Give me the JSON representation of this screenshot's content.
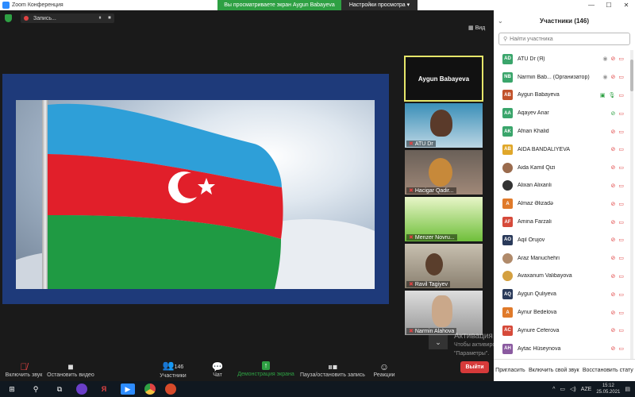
{
  "window": {
    "title": "Zoom Конференция"
  },
  "topbar": {
    "recording_label": "Запись...",
    "pause_icon": "⏸",
    "stop_icon": "⏹",
    "share_banner": "Вы просматриваете экран Aygun Babayeva",
    "view_options": "Настройки просмотра",
    "view_label": "Вид"
  },
  "video": {
    "self_view_name": "Aygun Babayeva",
    "tiles": [
      {
        "name": "ATU Dr"
      },
      {
        "name": "Hacigar Qadir..."
      },
      {
        "name": "Menzer Novru..."
      },
      {
        "name": "Ravil Tagiyev"
      },
      {
        "name": "Narmin Alahova"
      }
    ]
  },
  "watermark": {
    "line1": "Активация Windows",
    "line2": "Чтобы активировать Windows, перейдите в раздел",
    "line3": "\"Параметры\"."
  },
  "controls": {
    "mute": "Включить звук",
    "video": "Остановить видео",
    "participants": "Участники",
    "participants_count": "146",
    "chat": "Чат",
    "share": "Демонстрация экрана",
    "pause_share": "Пауза/остановить запись",
    "reactions": "Реакции",
    "leave": "Выйти"
  },
  "panel": {
    "title": "Участники (146)",
    "search_placeholder": "Найти участника",
    "participants": [
      {
        "initials": "AD",
        "name": "ATU Dr (Я)",
        "color": "#3aa56b",
        "photo": false
      },
      {
        "initials": "NB",
        "name": "Narmin Bab... (Организатор)",
        "color": "#3aa56b",
        "photo": false
      },
      {
        "initials": "AB",
        "name": "Aygun Babayeva",
        "color": "#c1522a",
        "photo": false
      },
      {
        "initials": "AA",
        "name": "Aqayev Anar",
        "color": "#3aa56b",
        "photo": false
      },
      {
        "initials": "AK",
        "name": "Afnan Khalid",
        "color": "#3aa56b",
        "photo": false
      },
      {
        "initials": "AB",
        "name": "AIDA BANDALIYEVA",
        "color": "#e0a72a",
        "photo": false
      },
      {
        "initials": "",
        "name": "Aida Kamil Qizi",
        "color": "#9a6b4d",
        "photo": true
      },
      {
        "initials": "",
        "name": "Alixan Alixanli",
        "color": "#333333",
        "photo": true
      },
      {
        "initials": "A",
        "name": "Almaz Əlizadə",
        "color": "#e07a2a",
        "photo": false
      },
      {
        "initials": "AF",
        "name": "Amina Farzali",
        "color": "#d64a3a",
        "photo": false
      },
      {
        "initials": "AO",
        "name": "Aqil Orujov",
        "color": "#2a3a5a",
        "photo": false
      },
      {
        "initials": "",
        "name": "Araz Manuchehri",
        "color": "#b08a6a",
        "photo": true
      },
      {
        "initials": "",
        "name": "Avaxanum Valibayova",
        "color": "#d4a040",
        "photo": true
      },
      {
        "initials": "AQ",
        "name": "Aygun Quliyeva",
        "color": "#2a3a5a",
        "photo": false
      },
      {
        "initials": "A",
        "name": "Aynur Bedelova",
        "color": "#e07a2a",
        "photo": false
      },
      {
        "initials": "AC",
        "name": "Aynure Ceferova",
        "color": "#d64a3a",
        "photo": false
      },
      {
        "initials": "AH",
        "name": "Aytac Hüseynova",
        "color": "#8a5aa0",
        "photo": false
      }
    ],
    "footer": {
      "invite": "Пригласить",
      "unmute_self": "Включить свой звук",
      "restore": "Восстановить стату"
    }
  },
  "taskbar": {
    "language": "AZE",
    "time": "15:12",
    "date": "25.05.2021"
  }
}
